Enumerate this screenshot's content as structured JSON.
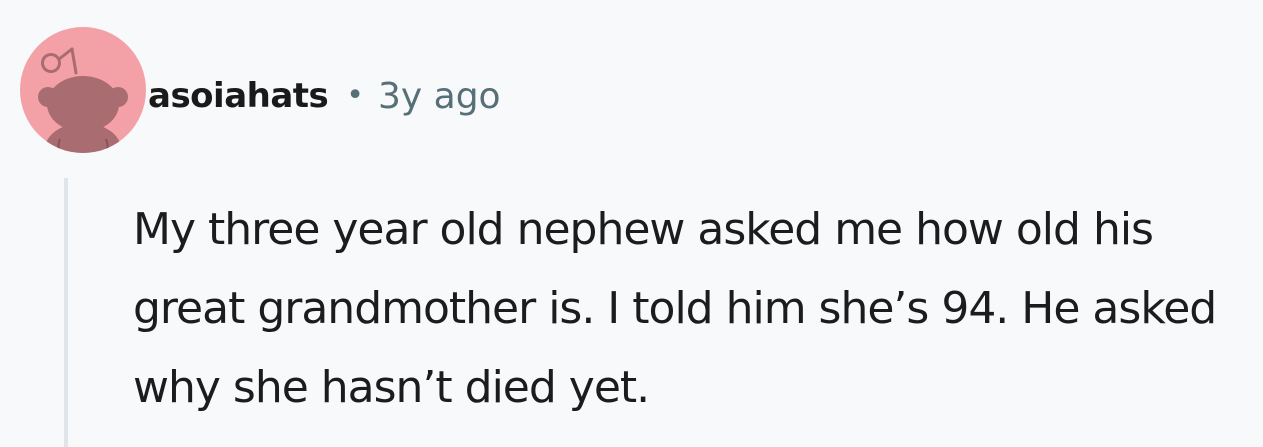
{
  "comment": {
    "username": "asoiahats",
    "separator": "•",
    "timestamp": "3y ago",
    "body": "My three year old nephew asked me how old his great grandmother is. I told him she’s 94. He asked why she hasn’t died yet.",
    "avatar_icon": "snoo-avatar-icon"
  },
  "colors": {
    "background": "#f7f9fb",
    "avatar_bg": "#f4a0a7",
    "avatar_figure": "#a86c71",
    "username": "#1a1a1b",
    "meta": "#576f76",
    "thread_line": "#dfe5e9",
    "body_text": "#1c1c1d"
  }
}
